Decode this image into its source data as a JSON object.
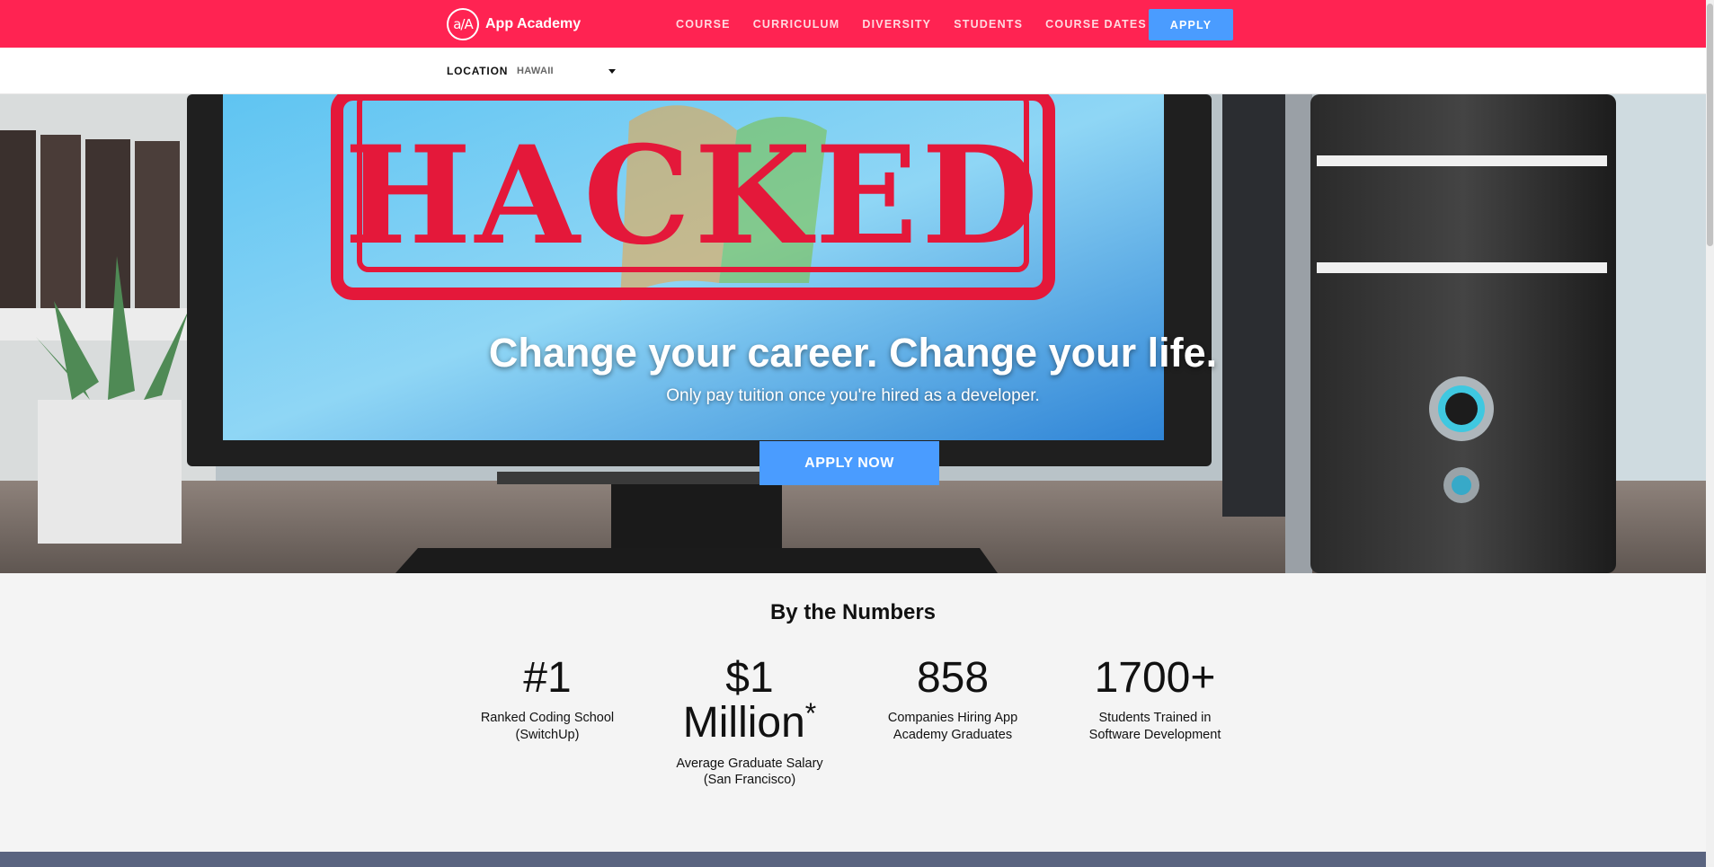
{
  "nav": {
    "logo_mark": "a/A",
    "logo_text": "App Academy",
    "links": [
      "COURSE",
      "CURRICULUM",
      "DIVERSITY",
      "STUDENTS",
      "COURSE DATES"
    ],
    "apply_label": "APPLY"
  },
  "location": {
    "label": "LOCATION",
    "value": "HAWAII"
  },
  "hero": {
    "stamp_text": "HACKED",
    "title": "Change your career. Change your life.",
    "subtitle": "Only pay tuition once you're hired as a developer.",
    "cta_label": "APPLY NOW"
  },
  "numbers": {
    "title": "By the Numbers",
    "stats": [
      {
        "value": "#1",
        "label": "Ranked Coding School (SwitchUp)"
      },
      {
        "value_line1": "$1",
        "value_line2": "Million",
        "footnote": "*",
        "label": "Average Graduate Salary (San Francisco)"
      },
      {
        "value": "858",
        "label": "Companies Hiring App Academy Graduates"
      },
      {
        "value": "1700+",
        "label": "Students Trained in Software Development"
      }
    ]
  },
  "colors": {
    "brand_red": "#ff2352",
    "button_blue": "#4a9cff",
    "stats_bg": "#f4f4f4"
  }
}
